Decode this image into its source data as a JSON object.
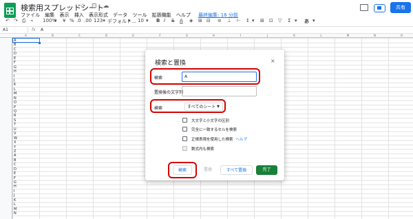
{
  "header": {
    "title": "検索用スプレッドシート",
    "icons": [
      "☆",
      "⊡",
      "☁"
    ],
    "menu": [
      "ファイル",
      "編集",
      "表示",
      "挿入",
      "表示形式",
      "データ",
      "ツール",
      "拡張機能",
      "ヘルプ"
    ],
    "last_edit": "最終編集: 18 分前",
    "share_label": "共有"
  },
  "toolbar": {
    "items": [
      "↶",
      "↷",
      "⎙",
      "⌁",
      "100%",
      "▾",
      "¥",
      "%",
      ".0",
      ".00",
      "123▾",
      "デフォルト...",
      "▾",
      "10",
      "▾",
      "B",
      "I",
      "S",
      "A",
      "◈",
      "⊞",
      "⊟",
      "≡",
      "⊥",
      "⊢",
      "↕",
      "▾",
      "⊞",
      "⊡",
      "▽",
      "Σ",
      "▾",
      "あ",
      "▾"
    ]
  },
  "formula_bar": {
    "cell_ref": "A1",
    "fx": "fx",
    "value": "A"
  },
  "sheet": {
    "columns": [
      "A",
      "B",
      "C",
      "D",
      "E",
      "F",
      "G",
      "H",
      "I",
      "J",
      "K",
      "L",
      "M",
      "N",
      "O"
    ],
    "column_a_values": [
      "A",
      "B",
      "C",
      "D",
      "E",
      "F",
      "G",
      "H",
      "I",
      "J",
      "K",
      "L",
      "M",
      "N",
      "O",
      "P",
      "Q",
      "R",
      "S",
      "T",
      "U",
      "V",
      "W",
      "X",
      "Y",
      "Z",
      "A",
      "B",
      "C",
      "D",
      "E",
      "F",
      "G",
      "H",
      "I",
      "J",
      "K",
      "L",
      "M",
      "N"
    ]
  },
  "dialog": {
    "title": "検索と置換",
    "close": "×",
    "search_label": "検索",
    "search_value": "A",
    "replace_label": "置換後の文字列",
    "replace_value": "",
    "scope_label": "検索",
    "scope_value": "すべてのシート",
    "options": [
      "大文字と小文字の区別",
      "完全に一致するセルを検索",
      "正規表現を使用した検索",
      "数式内も検索"
    ],
    "help_link": "ヘルプ",
    "buttons": {
      "find": "検索",
      "replace": "置換",
      "replace_all": "すべて置換",
      "done": "完了"
    }
  }
}
